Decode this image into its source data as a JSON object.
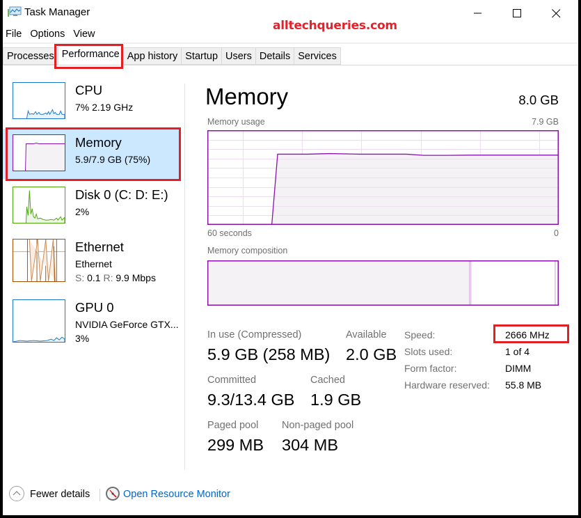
{
  "window": {
    "title": "Task Manager",
    "watermark": "alltechqueries.com",
    "controls": [
      "minimize",
      "maximize",
      "close"
    ]
  },
  "menu": [
    "File",
    "Options",
    "View"
  ],
  "tabs": [
    {
      "label": "Processes",
      "active": false
    },
    {
      "label": "Performance",
      "active": true
    },
    {
      "label": "App history",
      "active": false
    },
    {
      "label": "Startup",
      "active": false
    },
    {
      "label": "Users",
      "active": false
    },
    {
      "label": "Details",
      "active": false
    },
    {
      "label": "Services",
      "active": false
    }
  ],
  "sidebar": {
    "items": [
      {
        "name": "CPU",
        "line1": "7% 2.19 GHz",
        "color": "#1979ca",
        "selected": false
      },
      {
        "name": "Memory",
        "line1": "5.9/7.9 GB (75%)",
        "color": "#8b12ae",
        "selected": true
      },
      {
        "name": "Disk 0 (C: D: E:)",
        "line1": "2%",
        "color": "#4da60c",
        "selected": false
      },
      {
        "name": "Ethernet",
        "line1": "Ethernet",
        "s_label": "S:",
        "s_value": "0.1",
        "r_label": "R:",
        "r_value": "9.9 Mbps",
        "color": "#a74f01",
        "selected": false
      },
      {
        "name": "GPU 0",
        "line1": "NVIDIA GeForce GTX...",
        "line2": "3%",
        "color": "#1979ca",
        "selected": false
      }
    ]
  },
  "main": {
    "title": "Memory",
    "total": "8.0 GB",
    "usage_label": "Memory usage",
    "usage_max": "7.9 GB",
    "time_left": "60 seconds",
    "time_right": "0",
    "composition_label": "Memory composition",
    "stats": {
      "in_use_label": "In use (Compressed)",
      "in_use_value": "5.9 GB (258 MB)",
      "available_label": "Available",
      "available_value": "2.0 GB",
      "committed_label": "Committed",
      "committed_value": "9.3/13.4 GB",
      "cached_label": "Cached",
      "cached_value": "1.9 GB",
      "paged_label": "Paged pool",
      "paged_value": "299 MB",
      "nonpaged_label": "Non-paged pool",
      "nonpaged_value": "304 MB"
    },
    "info": [
      {
        "label": "Speed:",
        "value": "2666 MHz"
      },
      {
        "label": "Slots used:",
        "value": "1 of 4"
      },
      {
        "label": "Form factor:",
        "value": "DIMM"
      },
      {
        "label": "Hardware reserved:",
        "value": "55.8 MB"
      }
    ]
  },
  "footer": {
    "fewer_details": "Fewer details",
    "resource_monitor": "Open Resource Monitor"
  },
  "colors": {
    "memory_accent": "#8b12ae",
    "memory_fill": "#f4f2f4",
    "grid": "#efdcf2",
    "highlight": "#e31e24",
    "selected_bg": "#cce8ff",
    "link": "#0066cc"
  },
  "chart_data": {
    "type": "area",
    "title": "Memory usage",
    "xlabel": "",
    "ylabel": "",
    "x_range_label": [
      "60 seconds",
      "0"
    ],
    "ylim": [
      0,
      7.9
    ],
    "y_unit": "GB",
    "x": [
      60,
      49,
      48,
      43,
      39,
      34,
      30,
      26,
      23,
      19,
      15,
      10,
      5,
      0
    ],
    "values": [
      0,
      0,
      5.9,
      5.9,
      5.95,
      5.9,
      5.9,
      5.9,
      5.8,
      5.8,
      5.82,
      5.82,
      5.82,
      5.82
    ],
    "composition": {
      "in_use_fraction": 0.746,
      "modified_fraction": 0.004,
      "standby_fraction": 0.24,
      "free_fraction": 0.01
    }
  }
}
